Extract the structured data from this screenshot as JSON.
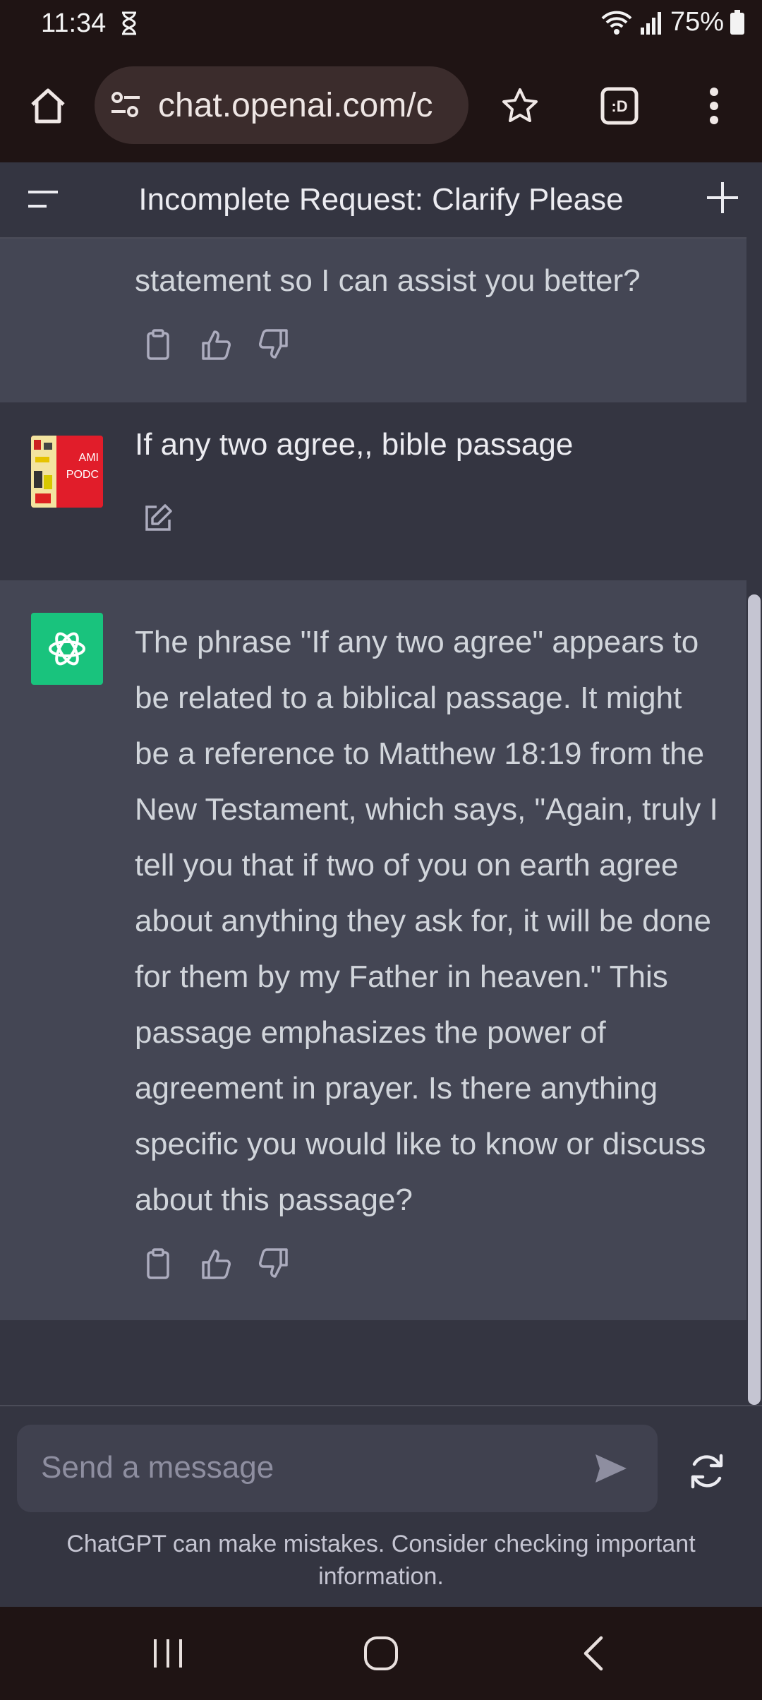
{
  "status_bar": {
    "time": "11:34",
    "battery": "75%"
  },
  "browser": {
    "url": "chat.openai.com/c",
    "tab_label": ":D"
  },
  "chat": {
    "title": "Incomplete Request: Clarify Please",
    "prev_ai_partial": "statement so I can assist you better?",
    "user_message": "If any two agree,,  bible passage",
    "user_avatar_text": "AMI PODC",
    "ai_message": "The phrase \"If any two agree\" appears to be related to a biblical passage. It might be a reference to Matthew 18:19 from the New Testament, which says, \"Again, truly I tell you that if two of you on earth agree about anything they ask for, it will be done for them by my Father in heaven.\" This passage emphasizes the power of agreement in prayer. Is there anything specific you would like to know or discuss about this passage?"
  },
  "composer": {
    "placeholder": "Send a message",
    "disclaimer": "ChatGPT can make mistakes. Consider checking important information."
  },
  "colors": {
    "accent_green": "#19c37d",
    "ai_bg": "#444654",
    "user_bg": "#343541"
  },
  "icons": [
    "home-icon",
    "site-settings-icon",
    "star-icon",
    "tab-switcher-icon",
    "more-icon",
    "menu-icon",
    "plus-icon",
    "copy-icon",
    "thumbs-up-icon",
    "thumbs-down-icon",
    "edit-icon",
    "send-icon",
    "refresh-icon"
  ]
}
